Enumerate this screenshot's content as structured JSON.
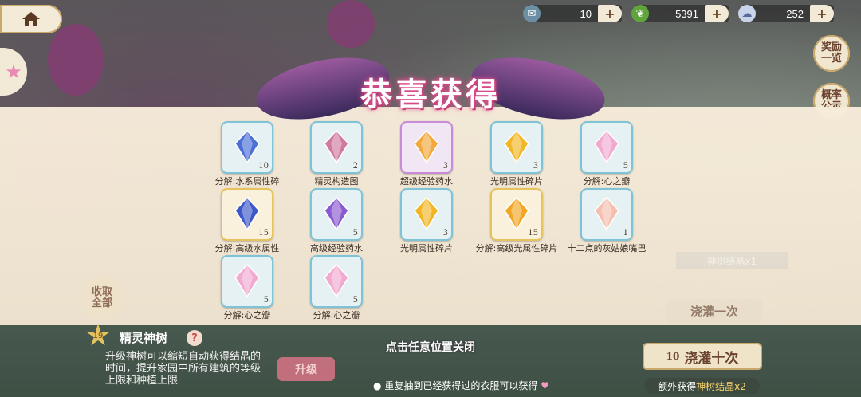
{
  "top_bar": {
    "resources": [
      {
        "icon": "ticket-icon",
        "value": "10"
      },
      {
        "icon": "leaf-icon",
        "value": "5391"
      },
      {
        "icon": "cloud-icon",
        "value": "252"
      }
    ],
    "plus_label": "+"
  },
  "side": {
    "rewards_overview": "奖励\n一览",
    "probability": "概率\n公示"
  },
  "banner": {
    "title": "恭喜获得"
  },
  "items": [
    {
      "label": "分解:水系属性碎",
      "count": "10",
      "color": "#4a6fd6",
      "frame": "blue"
    },
    {
      "label": "精灵构造图",
      "count": "2",
      "color": "#d07aa0",
      "frame": "blue"
    },
    {
      "label": "超级经验药水",
      "count": "3",
      "color": "#f2a83a",
      "frame": "purple"
    },
    {
      "label": "光明属性碎片",
      "count": "3",
      "color": "#f2b524",
      "frame": "blue"
    },
    {
      "label": "分解:心之瓣",
      "count": "5",
      "color": "#f2a9d0",
      "frame": "blue"
    },
    {
      "label": "分解:高级水属性",
      "count": "15",
      "color": "#3d57c9",
      "frame": "gold"
    },
    {
      "label": "高级经验药水",
      "count": "5",
      "color": "#8a5ad0",
      "frame": "blue"
    },
    {
      "label": "光明属性碎片",
      "count": "3",
      "color": "#f2b524",
      "frame": "blue"
    },
    {
      "label": "分解:高级光属性碎片",
      "count": "15",
      "color": "#f2a624",
      "frame": "gold"
    },
    {
      "label": "十二点的灰姑娘嘴巴",
      "count": "1",
      "color": "#f4bfae",
      "frame": "blue"
    },
    {
      "label": "分解:心之瓣",
      "count": "5",
      "color": "#f2a9d0",
      "frame": "blue"
    },
    {
      "label": "分解:心之瓣",
      "count": "5",
      "color": "#f2a9d0",
      "frame": "blue"
    }
  ],
  "close_hint": "点击任意位置关闭",
  "tree": {
    "level": "19",
    "title": "精灵神树",
    "help": "?",
    "description": "升级神树可以缩短自动获得结晶的时间，提升家园中所有建筑的等级上限和种植上限",
    "upgrade": "升级",
    "collect_all": "收取\n全部"
  },
  "notice": "重复抽到已经获得过的衣服可以获得",
  "right_panel": {
    "crystal_card": "神树结晶x1",
    "water_once": "浇灌一次",
    "water_ten_count": "10",
    "water_ten": "浇灌十次",
    "extra_prefix": "额外获得",
    "extra_item": "神树结晶x2"
  }
}
